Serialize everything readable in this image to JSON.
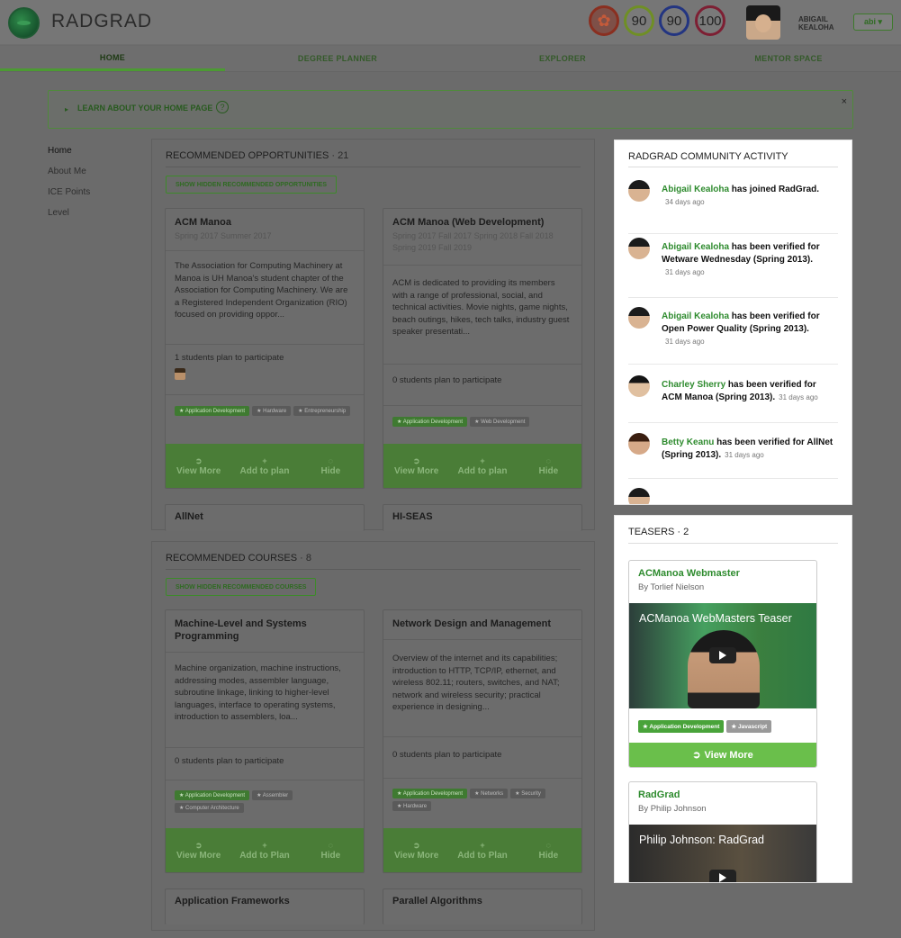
{
  "app": {
    "name": "RADGRAD"
  },
  "header": {
    "badges": [
      {
        "label": "",
        "color": "#9b3a2a",
        "icon": "flower-icon"
      },
      {
        "label": "90",
        "color": "#7a9a30"
      },
      {
        "label": "90",
        "color": "#2d3f8a"
      },
      {
        "label": "100",
        "color": "#8a2a3a"
      }
    ],
    "user_name": "ABIGAIL KEALOHA",
    "user_button": "abi ▾"
  },
  "tabs": [
    "HOME",
    "DEGREE PLANNER",
    "EXPLORER",
    "MENTOR SPACE"
  ],
  "learn": {
    "text": "LEARN ABOUT YOUR HOME PAGE",
    "help": "?",
    "close": "×"
  },
  "sidemenu": [
    "Home",
    "About Me",
    "ICE Points",
    "Level"
  ],
  "opportunities": {
    "title": "RECOMMENDED OPPORTUNITIES",
    "count": "· 21",
    "hidden_button": "SHOW HIDDEN RECOMMENDED OPPORTUNITIES",
    "cards": [
      {
        "title": "ACM Manoa",
        "sub": "Spring 2017  Summer 2017",
        "desc": "The Association for Computing Machinery at Manoa is UH Manoa's student chapter of the Association for Computing Machinery. We are a Registered Independent Organization (RIO) focused on providing oppor...",
        "plan": "1 students plan to participate",
        "tags": [
          "★ Application Development",
          "★ Hardware",
          "★ Entrepreneurship"
        ]
      },
      {
        "title": "ACM Manoa (Web Development)",
        "sub": "Spring 2017  Fall 2017  Spring 2018  Fall 2018  Spring 2019  Fall 2019",
        "desc": "ACM is dedicated to providing its members with a range of professional, social, and technical activities. Movie nights, game nights, beach outings, hikes, tech talks, industry guest speaker presentati...",
        "plan": "0 students plan to participate",
        "tags": [
          "★ Application Development",
          "★ Web Development"
        ]
      }
    ],
    "actions": {
      "view": "View More",
      "add": "Add to plan",
      "hide": "Hide"
    },
    "next": [
      "AllNet",
      "HI-SEAS"
    ]
  },
  "courses": {
    "title": "RECOMMENDED COURSES",
    "count": "· 8",
    "hidden_button": "SHOW HIDDEN RECOMMENDED COURSES",
    "cards": [
      {
        "title": "Machine-Level and Systems Programming",
        "desc": "Machine organization, machine instructions, addressing modes, assembler language, subroutine linkage, linking to higher-level languages, interface to operating systems, introduction to assemblers, loa...",
        "plan": "0 students plan to participate",
        "tags": [
          "★ Application Development",
          "★ Assembler",
          "★ Computer Architecture"
        ]
      },
      {
        "title": "Network Design and Management",
        "desc": "Overview of the internet and its capabilities; introduction to HTTP, TCP/IP, ethernet, and wireless 802.11; routers, switches, and NAT; network and wireless security; practical experience in designing...",
        "plan": "0 students plan to participate",
        "tags": [
          "★ Application Development",
          "★ Networks",
          "★ Security",
          "★ Hardware"
        ]
      }
    ],
    "actions": {
      "view": "View More",
      "add": "Add to Plan",
      "hide": "Hide"
    },
    "next": [
      "Application Frameworks",
      "Parallel Algorithms"
    ]
  },
  "community": {
    "title": "RADGRAD COMMUNITY ACTIVITY",
    "items": [
      {
        "who": "Abigail Kealoha",
        "what": " has joined RadGrad.",
        "time": "34 days ago"
      },
      {
        "who": "Abigail Kealoha",
        "what": " has been verified for Wetware Wednesday (Spring 2013).",
        "time": "31 days ago"
      },
      {
        "who": "Abigail Kealoha",
        "what": " has been verified for Open Power Quality (Spring 2013).",
        "time": "31 days ago"
      },
      {
        "who": "Charley Sherry",
        "what": " has been verified for ACM Manoa (Spring 2013).",
        "time": "31 days ago"
      },
      {
        "who": "Betty Keanu",
        "what": " has been verified for AllNet (Spring 2013).",
        "time": "31 days ago"
      }
    ]
  },
  "teasers": {
    "title": "TEASERS",
    "count": "· 2",
    "items": [
      {
        "title": "ACManoa Webmaster",
        "by": "By Torlief Nielson",
        "video_title": "ACManoa WebMasters Teaser",
        "tags": [
          "★ Application Development",
          "★ Javascript"
        ],
        "view": "View More"
      },
      {
        "title": "RadGrad",
        "by": "By Philip Johnson",
        "video_title": "Philip Johnson: RadGrad"
      }
    ]
  }
}
